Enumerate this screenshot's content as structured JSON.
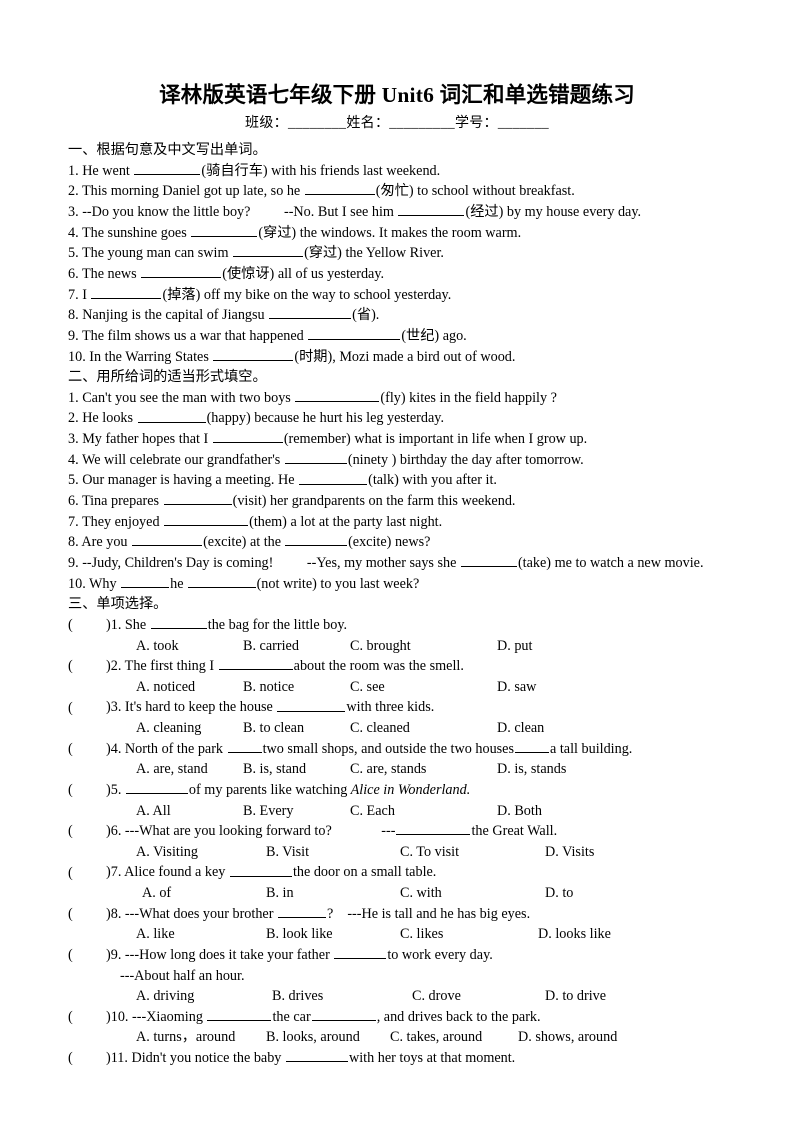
{
  "document": {
    "title": "译林版英语七年级下册 Unit6 词汇和单选错题练习",
    "info_line": "班级：________姓名：_________学号：_______"
  },
  "section1": {
    "heading": "一、根据句意及中文写出单词。",
    "items": [
      {
        "num": "1.",
        "before": "He went",
        "blank": 66,
        "hint": "(骑自行车)",
        "after": "with his friends last weekend."
      },
      {
        "num": "2.",
        "before": "This morning Daniel got up late, so he",
        "blank": 70,
        "hint": "(匆忙)",
        "after": "to school without breakfast."
      },
      {
        "num": "3.",
        "before": "--Do you know the little boy?",
        "mid": "--No. But I see him",
        "blank": 66,
        "hint": "(经过)",
        "after": "by my house every day."
      },
      {
        "num": "4.",
        "before": "The sunshine goes",
        "blank": 66,
        "hint": "(穿过)",
        "after": "the windows. It makes the room warm."
      },
      {
        "num": "5.",
        "before": "The young man can swim",
        "blank": 70,
        "hint": "(穿过)",
        "after": "the Yellow River."
      },
      {
        "num": "6.",
        "before": "The news",
        "blank": 80,
        "hint": "(使惊讶)",
        "after": "all of us yesterday."
      },
      {
        "num": "7.",
        "before": "I",
        "blank": 70,
        "hint": "(掉落)",
        "after": "off my bike on the way to school yesterday."
      },
      {
        "num": "8.",
        "before": "Nanjing is the capital of Jiangsu",
        "blank": 82,
        "hint": "(省).",
        "after": ""
      },
      {
        "num": "9.",
        "before": "The film shows us a war that happened",
        "blank": 92,
        "hint": "(世纪)",
        "after": "ago."
      },
      {
        "num": "10.",
        "before": "In the Warring States",
        "blank": 80,
        "hint": "(时期),",
        "after": "Mozi made a bird out of wood."
      }
    ]
  },
  "section2": {
    "heading": "二、用所给词的适当形式填空。",
    "items": [
      {
        "num": "1.",
        "before": "Can't you see the man with two boys",
        "blank": 84,
        "hint": "(fly)",
        "after": "kites in the field happily ?"
      },
      {
        "num": "2.",
        "before": "He looks",
        "blank": 68,
        "hint": "(happy)",
        "after": "because he hurt his leg yesterday."
      },
      {
        "num": "3.",
        "before": "My father hopes that I",
        "blank": 70,
        "hint": "(remember)",
        "after": "what is important in life when I grow up."
      },
      {
        "num": "4.",
        "before": "We will celebrate our grandfather's",
        "blank": 62,
        "hint": "(ninety )",
        "after": "birthday the day after tomorrow."
      },
      {
        "num": "5.",
        "before": "Our manager is having a meeting. He",
        "blank": 68,
        "hint": "(talk)",
        "after": "with you after it."
      },
      {
        "num": "6.",
        "before": "Tina prepares",
        "blank": 68,
        "hint": "(visit)",
        "after": "her grandparents on the farm this weekend."
      },
      {
        "num": "7.",
        "before": "They enjoyed",
        "blank": 84,
        "hint": "(them)",
        "after": "a lot at the party last night."
      },
      {
        "num": "8.",
        "before": "Are you",
        "blank": 70,
        "hint": "(excite)",
        "after": "at the",
        "blank2": 62,
        "hint2": "(excite)",
        "after2": "news?"
      },
      {
        "num": "9.",
        "before": "--Judy, Children's Day is coming!",
        "mid": "--Yes, my mother says she",
        "blank": 56,
        "hint": "(take)",
        "after": "me to watch a new movie."
      },
      {
        "num": "10.",
        "before": "Why",
        "blank": 48,
        "hint": "he",
        "blank2": 68,
        "hint2": "(not write)",
        "after2": "to you last week?"
      }
    ]
  },
  "section3": {
    "heading": "三、单项选择。",
    "questions": [
      {
        "num": ")1.",
        "stem_before": "She",
        "blank": 56,
        "stem_after": "the bag for the little boy.",
        "options": [
          "A. took",
          "B. carried",
          "C. brought",
          "D. put"
        ],
        "opt_x": [
          136,
          243,
          350,
          497
        ]
      },
      {
        "num": ")2.",
        "stem_before": "The first thing I",
        "blank": 74,
        "stem_after": "about the room was the smell.",
        "options": [
          "A. noticed",
          "B. notice",
          "C. see",
          "D. saw"
        ],
        "opt_x": [
          136,
          243,
          350,
          497
        ]
      },
      {
        "num": ")3.",
        "stem_before": "It's hard to keep the house",
        "blank": 68,
        "stem_after": "with three kids.",
        "options": [
          "A. cleaning",
          "B. to clean",
          "C. cleaned",
          "D. clean"
        ],
        "opt_x": [
          136,
          243,
          350,
          497
        ]
      },
      {
        "num": ")4.",
        "stem_before": "North of the park",
        "blank": 34,
        "stem_after": "two small shops, and outside the two houses",
        "blank2": 34,
        "stem_after2": "a tall building.",
        "options": [
          "A. are, stand",
          "B. is, stand",
          "C. are, stands",
          "D. is, stands"
        ],
        "opt_x": [
          136,
          243,
          350,
          497
        ]
      },
      {
        "num": ")5.",
        "stem_before": "",
        "blank": 62,
        "stem_after": "of my parents like watching",
        "italic": "Alice in Wonderland.",
        "options": [
          "A. All",
          "B. Every",
          "C. Each",
          "D. Both"
        ],
        "opt_x": [
          136,
          243,
          350,
          497
        ]
      },
      {
        "num": ")6.",
        "stem_before": "---What are you looking forward to?",
        "mid": "---",
        "blank": 74,
        "stem_after": "the Great Wall.",
        "options": [
          "A. Visiting",
          "B. Visit",
          "C. To visit",
          "D. Visits"
        ],
        "opt_x": [
          136,
          266,
          400,
          545
        ]
      },
      {
        "num": ")7.",
        "stem_before": "Alice found a key",
        "blank": 62,
        "stem_after": "the door on a small table.",
        "options": [
          "A. of",
          "B. in",
          "C. with",
          "D. to"
        ],
        "opt_x": [
          142,
          266,
          400,
          545
        ]
      },
      {
        "num": ")8.",
        "stem_before": "---What does your brother",
        "blank": 48,
        "stem_after": "?",
        "stem_after2": "---He is tall and he has big eyes.",
        "options": [
          "A. like",
          "B. look like",
          "C. likes",
          "D. looks like"
        ],
        "opt_x": [
          136,
          266,
          400,
          538
        ]
      },
      {
        "num": ")9.",
        "stem_before": "---How long does it take your father",
        "blank": 52,
        "stem_after": "to work every day.",
        "sub": "---About half an hour.",
        "options": [
          "A. driving",
          "B. drives",
          "C. drove",
          "D. to drive"
        ],
        "opt_x": [
          136,
          272,
          412,
          545
        ]
      },
      {
        "num": ")10.",
        "stem_before": "---Xiaoming",
        "blank": 64,
        "stem_after": "the car",
        "blank2": 64,
        "stem_after2": ", and drives back to the park.",
        "options": [
          "A. turns，around",
          "B. looks, around",
          "C. takes, around",
          "D. shows, around"
        ],
        "opt_x": [
          136,
          266,
          390,
          518
        ]
      },
      {
        "num": ")11.",
        "stem_before": "Didn't you notice the baby",
        "blank": 62,
        "stem_after": "with her toys at that moment.",
        "options": [],
        "opt_x": []
      }
    ]
  }
}
